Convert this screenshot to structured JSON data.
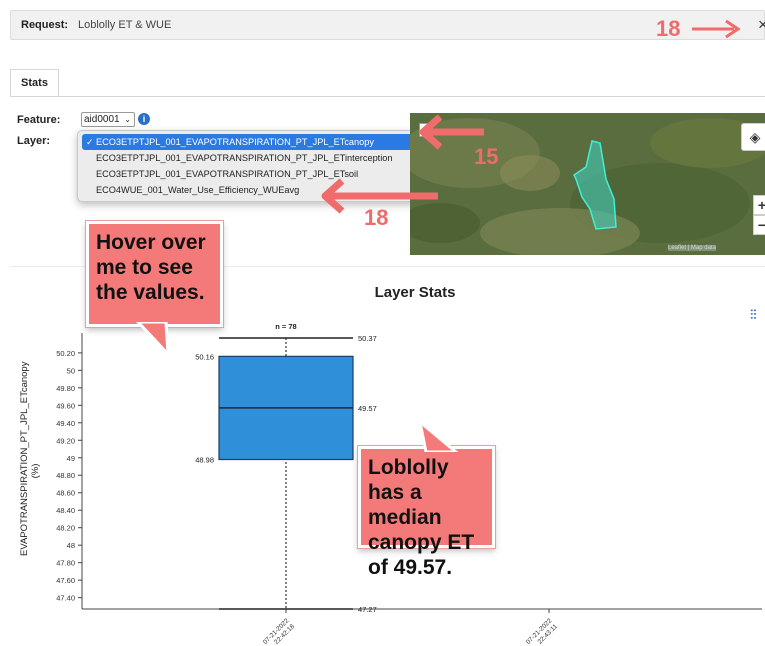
{
  "request": {
    "label": "Request:",
    "value": "Loblolly ET & WUE",
    "close": "×"
  },
  "tabs": [
    {
      "label": "Stats",
      "active": true
    }
  ],
  "form": {
    "feature_label": "Feature:",
    "feature_value": "aid0001",
    "layer_label": "Layer:",
    "layer_options": [
      {
        "label": "ECO3ETPTJPL_001_EVAPOTRANSPIRATION_PT_JPL_ETcanopy",
        "selected": true
      },
      {
        "label": "ECO3ETPTJPL_001_EVAPOTRANSPIRATION_PT_JPL_ETinterception",
        "selected": false
      },
      {
        "label": "ECO3ETPTJPL_001_EVAPOTRANSPIRATION_PT_JPL_ETsoil",
        "selected": false
      },
      {
        "label": "ECO4WUE_001_Water_Use_Efficiency_WUEavg",
        "selected": false
      }
    ]
  },
  "map": {
    "zoom_in": "+",
    "zoom_out": "−",
    "attribution": "Leaflet | Map data"
  },
  "annotations": {
    "num_top": "18",
    "num_map": "15",
    "num_dropdown": "18",
    "bubble_hover": "Hover over me to see the values.",
    "bubble_median": "Loblolly has a median canopy ET of 49.57."
  },
  "chart_data": {
    "type": "box",
    "title": "Layer Stats",
    "ylabel": "EVAPOTRANSPIRATION_PT_JPL_ETcanopy (%)",
    "yticks": [
      "47.40",
      "47.60",
      "47.80",
      "48",
      "48.20",
      "48.40",
      "48.60",
      "48.80",
      "49",
      "49.20",
      "49.40",
      "49.60",
      "49.80",
      "50",
      "50.20"
    ],
    "ylim": [
      47.27,
      50.37
    ],
    "x_categories": [
      "07-21-2022 22:42:18",
      "07-21-2022 22:43:11"
    ],
    "boxes": [
      {
        "x": "07-21-2022 22:42:18",
        "n_label": "n = 78",
        "min": 47.27,
        "q1": 48.98,
        "median": 49.57,
        "q3": 50.16,
        "max": 50.37,
        "labels": {
          "max": "50.37",
          "q3": "50.16",
          "median": "49.57",
          "q1": "48.98",
          "min": "47.27"
        }
      }
    ],
    "box_color": "#2f8fd8"
  }
}
